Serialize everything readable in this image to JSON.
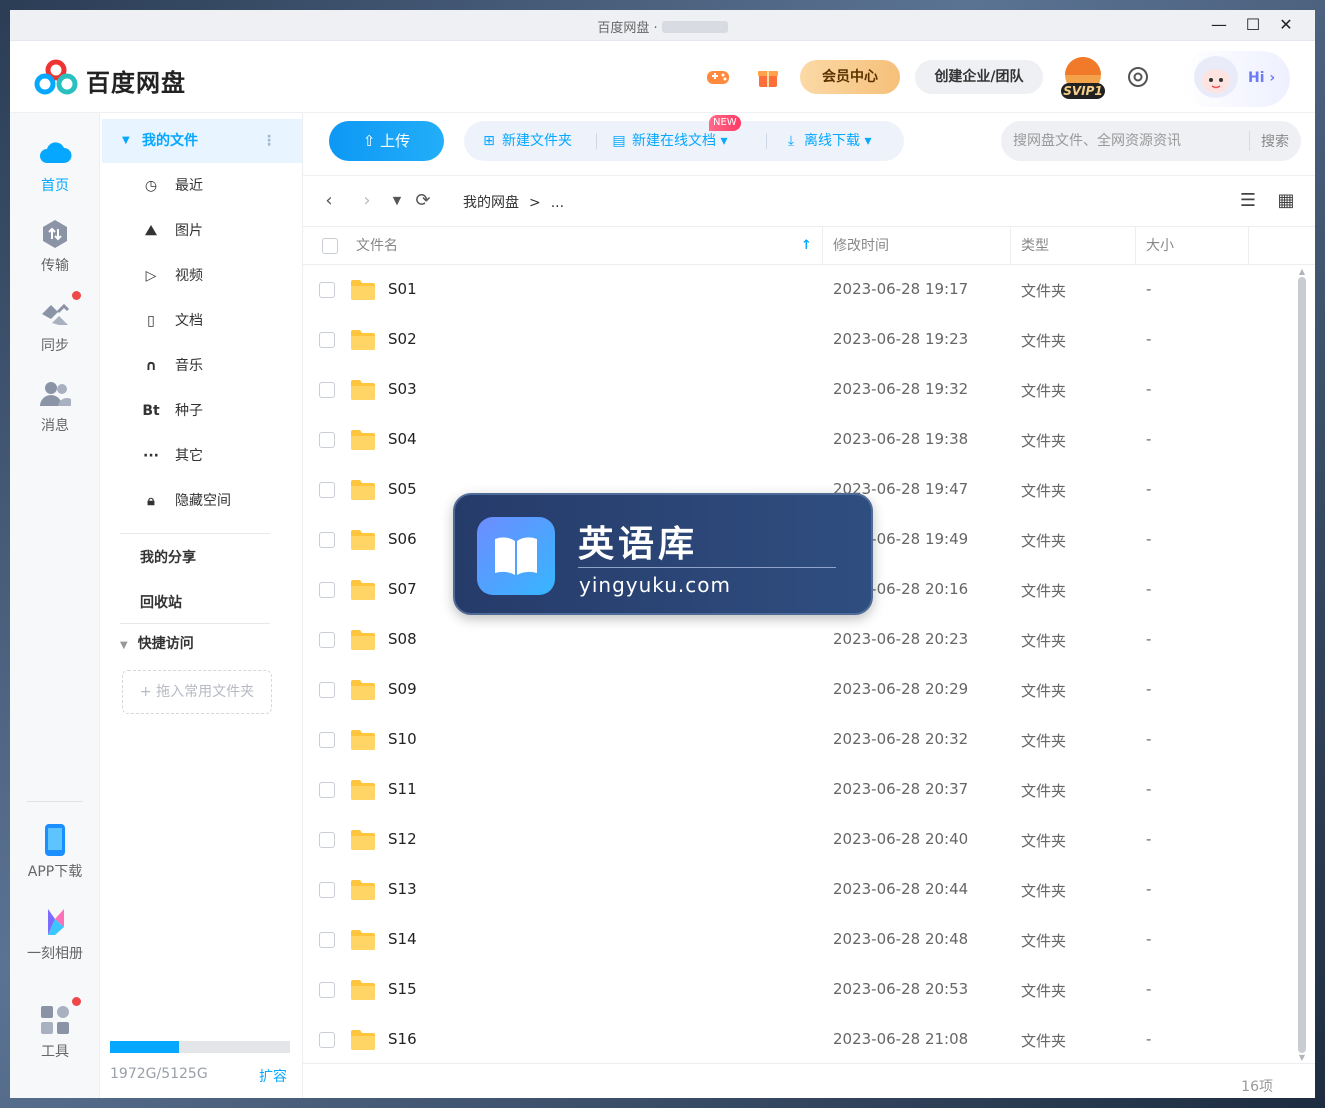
{
  "window": {
    "title": "百度网盘 ·",
    "controls": {
      "minimize": "—",
      "maximize": "☐",
      "close": "✕"
    }
  },
  "header": {
    "logo_text": "百度网盘",
    "vip_center": "会员中心",
    "create_team": "创建企业/团队",
    "badge_text": "SVIP1",
    "hi_text": "Hi ›"
  },
  "rail": {
    "items": [
      {
        "label": "首页",
        "icon": "cloud-icon",
        "active": true
      },
      {
        "label": "传输",
        "icon": "transfer-icon"
      },
      {
        "label": "同步",
        "icon": "sync-icon",
        "dot": true
      },
      {
        "label": "消息",
        "icon": "message-icon"
      },
      {
        "label": "APP下载",
        "icon": "phone-icon"
      },
      {
        "label": "一刻相册",
        "icon": "album-icon"
      },
      {
        "label": "工具",
        "icon": "tools-icon",
        "dot": true
      }
    ]
  },
  "nav": {
    "my_files": "我的文件",
    "items": [
      {
        "label": "最近",
        "icon": "clock-icon",
        "glyph": "◷"
      },
      {
        "label": "图片",
        "icon": "image-icon",
        "glyph": "⛰"
      },
      {
        "label": "视频",
        "icon": "video-icon",
        "glyph": "▷"
      },
      {
        "label": "文档",
        "icon": "document-icon",
        "glyph": "▯"
      },
      {
        "label": "音乐",
        "icon": "headphones-icon",
        "glyph": "∩"
      },
      {
        "label": "种子",
        "icon": "bt-icon",
        "glyph": "Bt"
      },
      {
        "label": "其它",
        "icon": "more-icon",
        "glyph": "···"
      },
      {
        "label": "隐藏空间",
        "icon": "lock-icon",
        "glyph": "🔒︎"
      }
    ],
    "my_share": "我的分享",
    "recycle_bin": "回收站",
    "quick_access": "快捷访问",
    "drop_folder": "+ 拖入常用文件夹",
    "storage": {
      "used_fraction": 0.385,
      "text": "1972G/5125G",
      "expand": "扩容"
    }
  },
  "toolbar": {
    "upload": "上传",
    "new_folder": "新建文件夹",
    "new_doc": "新建在线文档",
    "new_badge": "NEW",
    "offline_download": "离线下载",
    "search_placeholder": "搜网盘文件、全网资源资讯",
    "search_button": "搜索"
  },
  "breadcrumb": {
    "root": "我的网盘",
    "sep": ">",
    "rest": "..."
  },
  "table": {
    "headers": {
      "name": "文件名",
      "modified": "修改时间",
      "type": "类型",
      "size": "大小"
    },
    "rows": [
      {
        "name": "S01",
        "time": "2023-06-28 19:17",
        "type": "文件夹",
        "size": "-"
      },
      {
        "name": "S02",
        "time": "2023-06-28 19:23",
        "type": "文件夹",
        "size": "-"
      },
      {
        "name": "S03",
        "time": "2023-06-28 19:32",
        "type": "文件夹",
        "size": "-"
      },
      {
        "name": "S04",
        "time": "2023-06-28 19:38",
        "type": "文件夹",
        "size": "-"
      },
      {
        "name": "S05",
        "time": "2023-06-28 19:47",
        "type": "文件夹",
        "size": "-"
      },
      {
        "name": "S06",
        "time": "2023-06-28 19:49",
        "type": "文件夹",
        "size": "-"
      },
      {
        "name": "S07",
        "time": "2023-06-28 20:16",
        "type": "文件夹",
        "size": "-"
      },
      {
        "name": "S08",
        "time": "2023-06-28 20:23",
        "type": "文件夹",
        "size": "-"
      },
      {
        "name": "S09",
        "time": "2023-06-28 20:29",
        "type": "文件夹",
        "size": "-"
      },
      {
        "name": "S10",
        "time": "2023-06-28 20:32",
        "type": "文件夹",
        "size": "-"
      },
      {
        "name": "S11",
        "time": "2023-06-28 20:37",
        "type": "文件夹",
        "size": "-"
      },
      {
        "name": "S12",
        "time": "2023-06-28 20:40",
        "type": "文件夹",
        "size": "-"
      },
      {
        "name": "S13",
        "time": "2023-06-28 20:44",
        "type": "文件夹",
        "size": "-"
      },
      {
        "name": "S14",
        "time": "2023-06-28 20:48",
        "type": "文件夹",
        "size": "-"
      },
      {
        "name": "S15",
        "time": "2023-06-28 20:53",
        "type": "文件夹",
        "size": "-"
      },
      {
        "name": "S16",
        "time": "2023-06-28 21:08",
        "type": "文件夹",
        "size": "-"
      }
    ],
    "count": "16项"
  },
  "watermark": {
    "title": "英语库",
    "url": "yingyuku.com"
  },
  "colors": {
    "accent": "#06a7ff",
    "vip": "#f6c07a",
    "folder": "#ffc53d",
    "alert": "#f04848"
  }
}
